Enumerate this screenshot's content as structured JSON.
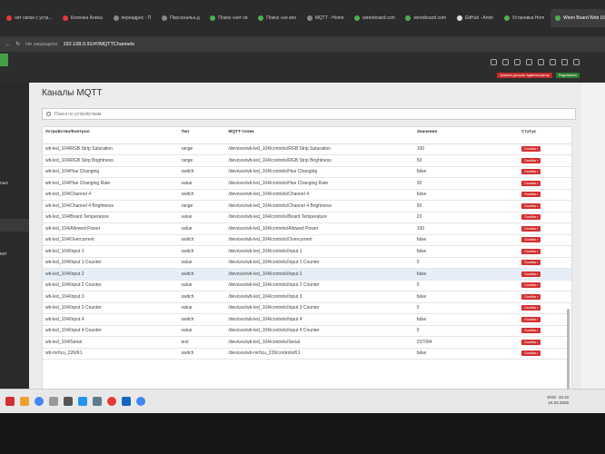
{
  "browser": {
    "tabs": [
      {
        "label": "нет связи с устр...",
        "fav": "red"
      },
      {
        "label": "Колонка Алиса",
        "fav": "red"
      },
      {
        "label": "переадрес - П",
        "fav": "gray"
      },
      {
        "label": "Персональн.д",
        "fav": "gray"
      },
      {
        "label": "Поиск «нет св",
        "fav": "green"
      },
      {
        "label": "Поиск «не вхо",
        "fav": "green"
      },
      {
        "label": "MQTT - Home",
        "fav": "gray"
      },
      {
        "label": "wirenboard.com",
        "fav": "green"
      },
      {
        "label": "wirenboard.com",
        "fav": "green"
      },
      {
        "label": "GitHub - Anoh",
        "fav": "git"
      },
      {
        "label": "Установка Hom",
        "fav": "green"
      },
      {
        "label": "Wiren Board Web UI",
        "fav": "green",
        "active": true
      }
    ],
    "secure_label": "Не защищено",
    "url": "192.168.0.91/#!/MQTTChannels"
  },
  "header": {
    "access_badge": "Уровень доступа: Администратор",
    "connected_badge": "Подключено"
  },
  "sidebar": {
    "item_a": "ные",
    "item_b": "ват"
  },
  "page": {
    "title": "Каналы MQTT",
    "search_placeholder": "Поиск по устройствам"
  },
  "table": {
    "headers": {
      "device": "Устройство/Контрол",
      "type": "Тип",
      "topic": "MQTT-топик",
      "value": "Значение",
      "status": "Статус"
    },
    "status_error": "Ошибка r",
    "rows": [
      {
        "device": "wb-led_104/RGB Strip Saturation",
        "type": "range",
        "topic": "/devices/wb-led_104/controls/RGB Strip Saturation",
        "value": "100"
      },
      {
        "device": "wb-led_104/RGB Strip Brightness",
        "type": "range",
        "topic": "/devices/wb-led_104/controls/RGB Strip Brightness",
        "value": "50"
      },
      {
        "device": "wb-led_104/Hue Changing",
        "type": "switch",
        "topic": "/devices/wb-led_104/controls/Hue Changing",
        "value": "false"
      },
      {
        "device": "wb-led_104/Hue Changing Rate",
        "type": "value",
        "topic": "/devices/wb-led_104/controls/Hue Changing Rate",
        "value": "30"
      },
      {
        "device": "wb-led_104/Channel 4",
        "type": "switch",
        "topic": "/devices/wb-led_104/controls/Channel 4",
        "value": "false"
      },
      {
        "device": "wb-led_104/Channel 4 Brightness",
        "type": "range",
        "topic": "/devices/wb-led_104/controls/Channel 4 Brightness",
        "value": "50"
      },
      {
        "device": "wb-led_104/Board Temperature",
        "type": "value",
        "topic": "/devices/wb-led_104/controls/Board Temperature",
        "value": "23"
      },
      {
        "device": "wb-led_104/Allowed Power",
        "type": "value",
        "topic": "/devices/wb-led_104/controls/Allowed Power",
        "value": "100"
      },
      {
        "device": "wb-led_104/Overcurrent",
        "type": "switch",
        "topic": "/devices/wb-led_104/controls/Overcurrent",
        "value": "false"
      },
      {
        "device": "wb-led_104/Input 1",
        "type": "switch",
        "topic": "/devices/wb-led_104/controls/Input 1",
        "value": "false"
      },
      {
        "device": "wb-led_104/Input 1 Counter",
        "type": "value",
        "topic": "/devices/wb-led_104/controls/Input 1 Counter",
        "value": "0"
      },
      {
        "device": "wb-led_104/Input 2",
        "type": "switch",
        "topic": "/devices/wb-led_104/controls/Input 2",
        "value": "false",
        "highlight": true
      },
      {
        "device": "wb-led_104/Input 2 Counter",
        "type": "value",
        "topic": "/devices/wb-led_104/controls/Input 2 Counter",
        "value": "0"
      },
      {
        "device": "wb-led_104/Input 3",
        "type": "switch",
        "topic": "/devices/wb-led_104/controls/Input 3",
        "value": "false"
      },
      {
        "device": "wb-led_104/Input 3 Counter",
        "type": "value",
        "topic": "/devices/wb-led_104/controls/Input 3 Counter",
        "value": "0"
      },
      {
        "device": "wb-led_104/Input 4",
        "type": "switch",
        "topic": "/devices/wb-led_104/controls/Input 4",
        "value": "false"
      },
      {
        "device": "wb-led_104/Input 4 Counter",
        "type": "value",
        "topic": "/devices/wb-led_104/controls/Input 4 Counter",
        "value": "0"
      },
      {
        "device": "wb-led_104/Serial",
        "type": "text",
        "topic": "/devices/wb-led_104/controls/Serial",
        "value": "237094"
      },
      {
        "device": "wb-mr6cu_226/K1",
        "type": "switch",
        "topic": "/devices/wb-mr6cu_226/controls/K1",
        "value": "false"
      }
    ]
  },
  "taskbar": {
    "lang": "ENG",
    "time": "18:16",
    "date": "24.02.2025"
  }
}
